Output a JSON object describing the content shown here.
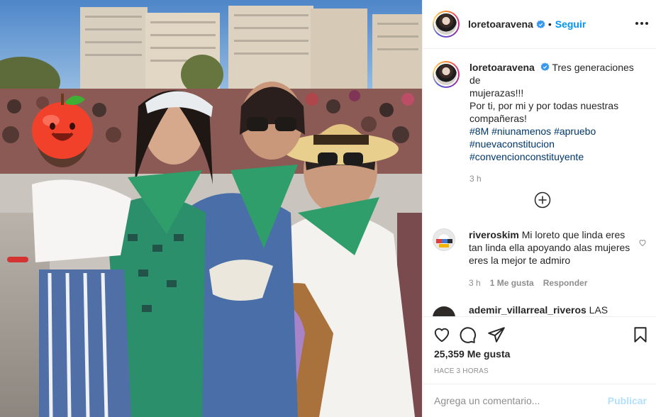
{
  "post": {
    "author": "loretoaravena",
    "follow_label": "Seguir",
    "dot": "•",
    "caption_lines": [
      "Tres generaciones de",
      "mujerazas!!!",
      "Por ti, por mi y por todas nuestras",
      "compañeras!"
    ],
    "hashtags": [
      "#8M",
      "#niunamenos",
      "#apruebo",
      "#nuevaconstitucion",
      "#convencionconstituyente"
    ],
    "caption_time": "3 h"
  },
  "comments": [
    {
      "user": "riveroskim",
      "text": "Mi loreto que linda eres tan linda ella apoyando alas mujeres eres la mejor te admiro",
      "time": "3 h",
      "likes": "1 Me gusta",
      "reply_label": "Responder"
    },
    {
      "user": "ademir_villarreal_riveros",
      "text": "LAS"
    }
  ],
  "actions": {
    "like_count": "25,359 Me gusta",
    "posted_when": "Hace 3 horas"
  },
  "composer": {
    "placeholder": "Agrega un comentario...",
    "publish_label": "Publicar"
  },
  "icons": {
    "verified": "verified-badge-icon",
    "more": "more-options-icon",
    "load_more": "plus-circle-icon",
    "like": "heart-icon",
    "comment": "comment-bubble-icon",
    "share": "paper-plane-icon",
    "save": "bookmark-icon"
  },
  "colors": {
    "link_blue": "#0095f6",
    "hashtag_blue": "#00376b",
    "muted": "#8e8e8e",
    "publish_disabled": "#b2dffc",
    "pañuelo_green": "#2f9e6a"
  }
}
